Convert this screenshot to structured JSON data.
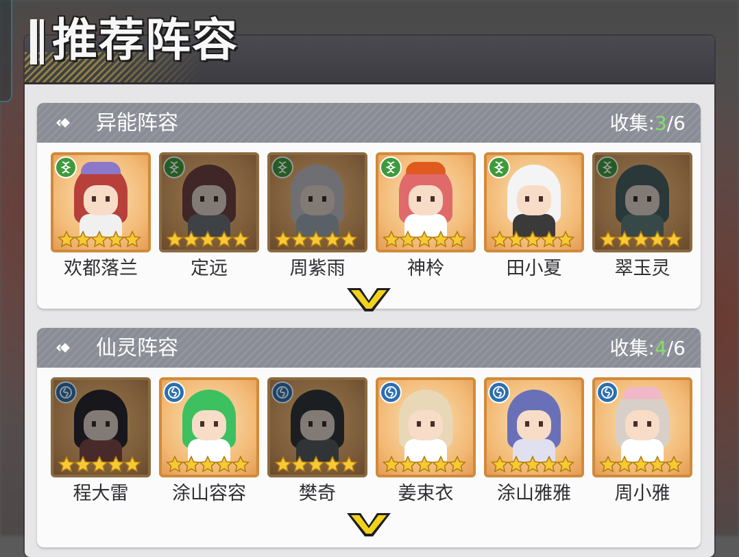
{
  "page": {
    "title": "推荐阵容",
    "accent_color": "#d6b83c"
  },
  "sections": [
    {
      "label": "异能阵容",
      "collect_prefix": "收集:",
      "collected": "3",
      "total": "/6",
      "type_icon": "dna-icon",
      "heroes": [
        {
          "name": "欢都落兰",
          "owned": true,
          "stars": 5,
          "hair": "#b8403a",
          "body": "#f0f0f0",
          "hat": "#8a78c8"
        },
        {
          "name": "定远",
          "owned": false,
          "stars": 5,
          "hair": "#9a3a3a",
          "body": "#6a7a8a",
          "hat": ""
        },
        {
          "name": "周紫雨",
          "owned": false,
          "stars": 5,
          "hair": "#c8c8d8",
          "body": "#9ab0c8",
          "hat": ""
        },
        {
          "name": "神柃",
          "owned": true,
          "stars": 5,
          "hair": "#e06a6a",
          "body": "#ffffff",
          "hat": "#e05a20"
        },
        {
          "name": "田小夏",
          "owned": true,
          "stars": 5,
          "hair": "#f4f4f4",
          "body": "#3a3a3a",
          "hat": ""
        },
        {
          "name": "翠玉灵",
          "owned": false,
          "stars": 5,
          "hair": "#3c6a70",
          "body": "#4a8a8a",
          "hat": ""
        }
      ]
    },
    {
      "label": "仙灵阵容",
      "collect_prefix": "收集:",
      "collected": "4",
      "total": "/6",
      "type_icon": "spirit-swirl-icon",
      "heroes": [
        {
          "name": "程大雷",
          "owned": false,
          "stars": 5,
          "hair": "#2a2a3a",
          "body": "#b04040",
          "hat": ""
        },
        {
          "name": "涂山容容",
          "owned": true,
          "stars": 5,
          "hair": "#3cc060",
          "body": "#ffffff",
          "hat": ""
        },
        {
          "name": "樊奇",
          "owned": false,
          "stars": 5,
          "hair": "#2f3a44",
          "body": "#55606a",
          "hat": ""
        },
        {
          "name": "姜束衣",
          "owned": true,
          "stars": 5,
          "hair": "#e8d8b8",
          "body": "#ffffff",
          "hat": ""
        },
        {
          "name": "涂山雅雅",
          "owned": true,
          "stars": 5,
          "hair": "#6a70b8",
          "body": "#e0e0f0",
          "hat": ""
        },
        {
          "name": "周小雅",
          "owned": true,
          "stars": 5,
          "hair": "#d8d0c8",
          "body": "#ffffff",
          "hat": "#f0b8c8"
        }
      ]
    }
  ]
}
